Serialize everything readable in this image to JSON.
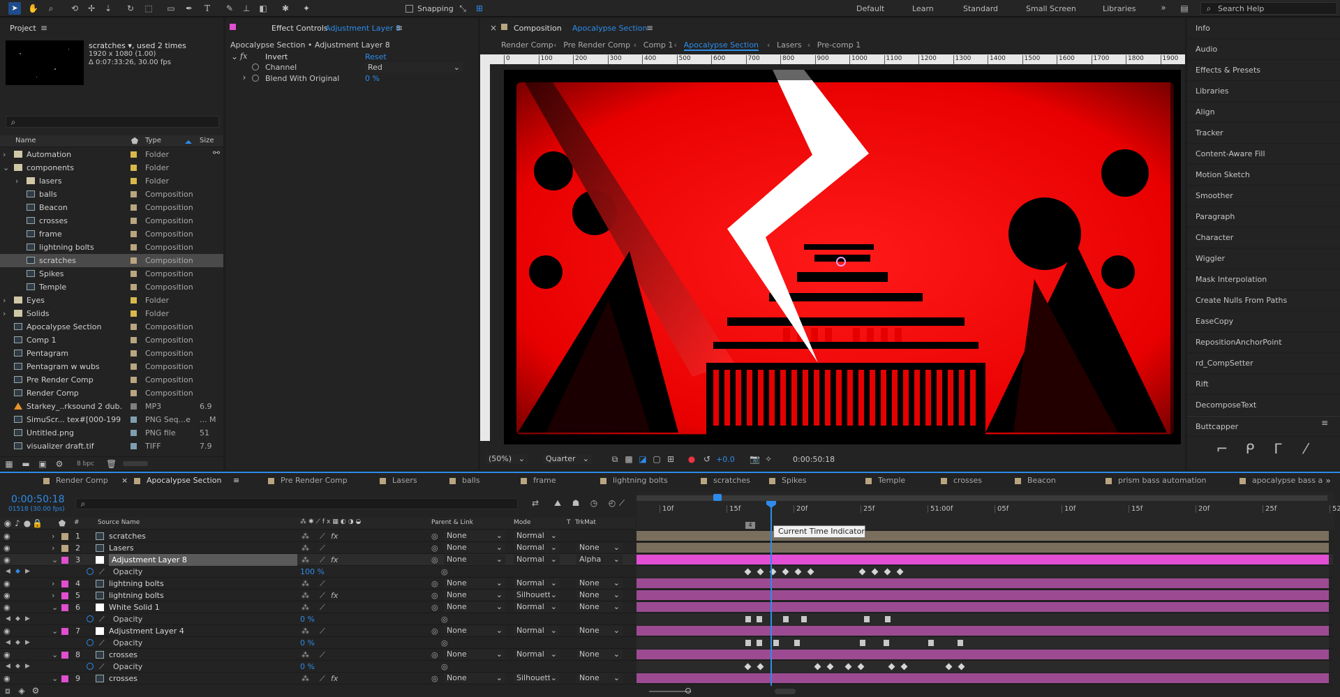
{
  "toolbar": {
    "snapping": "Snapping",
    "workspaces": [
      "Default",
      "Learn",
      "Standard",
      "Small Screen",
      "Libraries"
    ],
    "search_help": "Search Help"
  },
  "project": {
    "tab": "Project",
    "thumb_name": "scratches ▾, used 2 times",
    "thumb_res": "1920 x 1080 (1.00)",
    "thumb_dur": "Δ 0:07:33:26, 30.00 fps",
    "search_placeholder": "",
    "col_name": "Name",
    "col_type": "Type",
    "col_size": "Size",
    "bpc": "8 bpc",
    "items": [
      {
        "name": "Automation",
        "type": "Folder",
        "size": "",
        "kind": "folder",
        "indent": 0,
        "twirl": "›",
        "color": "#d7b94b"
      },
      {
        "name": "components",
        "type": "Folder",
        "size": "",
        "kind": "folder",
        "indent": 0,
        "twirl": "⌄",
        "color": "#d7b94b"
      },
      {
        "name": "lasers",
        "type": "Folder",
        "size": "",
        "kind": "folder",
        "indent": 1,
        "twirl": "›",
        "color": "#d7b94b"
      },
      {
        "name": "balls",
        "type": "Composition",
        "size": "",
        "kind": "comp",
        "indent": 1,
        "twirl": "",
        "color": "#b9a57f"
      },
      {
        "name": "Beacon",
        "type": "Composition",
        "size": "",
        "kind": "comp",
        "indent": 1,
        "twirl": "",
        "color": "#b9a57f"
      },
      {
        "name": "crosses",
        "type": "Composition",
        "size": "",
        "kind": "comp",
        "indent": 1,
        "twirl": "",
        "color": "#b9a57f"
      },
      {
        "name": "frame",
        "type": "Composition",
        "size": "",
        "kind": "comp",
        "indent": 1,
        "twirl": "",
        "color": "#b9a57f"
      },
      {
        "name": "lightning bolts",
        "type": "Composition",
        "size": "",
        "kind": "comp",
        "indent": 1,
        "twirl": "",
        "color": "#b9a57f"
      },
      {
        "name": "scratches",
        "type": "Composition",
        "size": "",
        "kind": "comp",
        "indent": 1,
        "twirl": "",
        "color": "#b9a57f",
        "selected": true
      },
      {
        "name": "Spikes",
        "type": "Composition",
        "size": "",
        "kind": "comp",
        "indent": 1,
        "twirl": "",
        "color": "#b9a57f"
      },
      {
        "name": "Temple",
        "type": "Composition",
        "size": "",
        "kind": "comp",
        "indent": 1,
        "twirl": "",
        "color": "#b9a57f"
      },
      {
        "name": "Eyes",
        "type": "Folder",
        "size": "",
        "kind": "folder",
        "indent": 0,
        "twirl": "›",
        "color": "#d7b94b"
      },
      {
        "name": "Solids",
        "type": "Folder",
        "size": "",
        "kind": "folder",
        "indent": 0,
        "twirl": "›",
        "color": "#d7b94b"
      },
      {
        "name": "Apocalypse Section",
        "type": "Composition",
        "size": "",
        "kind": "comp",
        "indent": 0,
        "twirl": "",
        "color": "#b9a57f"
      },
      {
        "name": "Comp 1",
        "type": "Composition",
        "size": "",
        "kind": "comp",
        "indent": 0,
        "twirl": "",
        "color": "#b9a57f"
      },
      {
        "name": "Pentagram",
        "type": "Composition",
        "size": "",
        "kind": "comp",
        "indent": 0,
        "twirl": "",
        "color": "#b9a57f"
      },
      {
        "name": "Pentagram w wubs",
        "type": "Composition",
        "size": "",
        "kind": "comp",
        "indent": 0,
        "twirl": "",
        "color": "#b9a57f"
      },
      {
        "name": "Pre Render Comp",
        "type": "Composition",
        "size": "",
        "kind": "comp",
        "indent": 0,
        "twirl": "",
        "color": "#b9a57f"
      },
      {
        "name": "Render Comp",
        "type": "Composition",
        "size": "",
        "kind": "comp",
        "indent": 0,
        "twirl": "",
        "color": "#b9a57f"
      },
      {
        "name": "Starkey_..rksound 2 dub.mp3",
        "type": "MP3",
        "size": "6.9",
        "kind": "audio",
        "indent": 0,
        "twirl": "",
        "color": "#7f7f7f"
      },
      {
        "name": "SimuScr... tex#[000-199].png",
        "type": "PNG Seq...e",
        "size": "... M",
        "kind": "seq",
        "indent": 0,
        "twirl": "",
        "color": "#7f9fb0"
      },
      {
        "name": "Untitled.png",
        "type": "PNG file",
        "size": "51",
        "kind": "img",
        "indent": 0,
        "twirl": "",
        "color": "#7f9fb0"
      },
      {
        "name": "visualizer draft.tif",
        "type": "TIFF",
        "size": "7.9",
        "kind": "tif",
        "indent": 0,
        "twirl": "",
        "color": "#7f9fb0"
      }
    ]
  },
  "effects": {
    "tab_prefix": "Effect Controls",
    "tab_layer": "Adjustment Layer 8",
    "subtitle": "Apocalypse Section • Adjustment Layer 8",
    "effect": "Invert",
    "reset": "Reset",
    "channel_label": "Channel",
    "channel_value": "Red",
    "blend_label": "Blend With Original",
    "blend_value": "0 %"
  },
  "composition": {
    "tab_prefix": "Composition",
    "tab_name": "Apocalypse Section",
    "crumbs": [
      "Render Comp",
      "Pre Render Comp",
      "Comp 1",
      "Apocalypse Section",
      "Lasers",
      "Pre-comp 1"
    ],
    "ruler": [
      "0",
      "100",
      "200",
      "300",
      "400",
      "500",
      "600",
      "700",
      "800",
      "900",
      "1000",
      "1100",
      "1200",
      "1300",
      "1400",
      "1500",
      "1600",
      "1700",
      "1800",
      "1900"
    ],
    "zoom": "(50%)",
    "resolution": "Quarter",
    "exposure": "+0.0",
    "timecode": "0:00:50:18"
  },
  "right_panels": [
    "Info",
    "Audio",
    "Effects & Presets",
    "Libraries",
    "Align",
    "Tracker",
    "Content-Aware Fill",
    "Motion Sketch",
    "Smoother",
    "Paragraph",
    "Character",
    "Wiggler",
    "Mask Interpolation",
    "Create Nulls From Paths",
    "EaseCopy",
    "RepositionAnchorPoint",
    "rd_CompSetter",
    "Rift",
    "DecomposeText",
    "Buttcapper"
  ],
  "timeline": {
    "tabs": [
      {
        "label": "Render Comp",
        "color": "#b9a57f"
      },
      {
        "label": "Apocalypse Section",
        "color": "#b9a57f",
        "active": true
      },
      {
        "label": "Pre Render Comp",
        "color": "#b9a57f"
      },
      {
        "label": "Lasers",
        "color": "#b9a57f"
      },
      {
        "label": "balls",
        "color": "#b9a57f"
      },
      {
        "label": "frame",
        "color": "#b9a57f"
      },
      {
        "label": "lightning bolts",
        "color": "#b9a57f"
      },
      {
        "label": "scratches",
        "color": "#b9a57f"
      },
      {
        "label": "Spikes",
        "color": "#b9a57f"
      },
      {
        "label": "Temple",
        "color": "#b9a57f"
      },
      {
        "label": "crosses",
        "color": "#b9a57f"
      },
      {
        "label": "Beacon",
        "color": "#b9a57f"
      },
      {
        "label": "prism bass automation",
        "color": "#b9a57f"
      },
      {
        "label": "apocalypse bass a",
        "color": "#b9a57f"
      }
    ],
    "timecode": "0:00:50:18",
    "frames": "01518 (30.00 fps)",
    "col_source": "Source Name",
    "col_parent": "Parent & Link",
    "col_mode": "Mode",
    "col_t": "T",
    "col_trkmat": "TrkMat",
    "ruler": [
      "10f",
      "15f",
      "20f",
      "25f",
      "51:00f",
      "05f",
      "10f",
      "15f",
      "20f",
      "25f",
      "52"
    ],
    "tooltip": "Current Time Indicator",
    "layers": [
      {
        "num": "1",
        "name": "scratches",
        "parent": "None",
        "mode": "Normal",
        "trk": "",
        "color": "#b9a57f",
        "kind": "comp",
        "fx": true,
        "bar": "#7a6f5c",
        "twirl": "›"
      },
      {
        "num": "2",
        "name": "Lasers",
        "parent": "None",
        "mode": "Normal",
        "trk": "None",
        "color": "#b9a57f",
        "kind": "comp",
        "fx": false,
        "bar": "#7a6f5c",
        "twirl": "›"
      },
      {
        "num": "3",
        "name": "Adjustment Layer 8",
        "parent": "None",
        "mode": "Normal",
        "trk": "Alpha",
        "color": "#e14fd0",
        "kind": "adj",
        "fx": true,
        "bar": "#d43fc6",
        "twirl": "⌄",
        "selected": true
      },
      {
        "prop": true,
        "name": "Opacity",
        "value": "100 %"
      },
      {
        "num": "4",
        "name": "lightning bolts",
        "parent": "None",
        "mode": "Normal",
        "trk": "None",
        "color": "#e14fd0",
        "kind": "comp",
        "fx": false,
        "bar": "#9c4b93",
        "twirl": "›"
      },
      {
        "num": "5",
        "name": "lightning bolts",
        "parent": "None",
        "mode": "Silhouett",
        "trk": "None",
        "color": "#e14fd0",
        "kind": "comp",
        "fx": true,
        "bar": "#9c4b93",
        "twirl": "›"
      },
      {
        "num": "6",
        "name": "White Solid 1",
        "parent": "None",
        "mode": "Normal",
        "trk": "None",
        "color": "#e14fd0",
        "kind": "solid",
        "fx": false,
        "bar": "#9c4b93",
        "twirl": "⌄"
      },
      {
        "prop": true,
        "name": "Opacity",
        "value": "0 %"
      },
      {
        "num": "7",
        "name": "Adjustment Layer 4",
        "parent": "None",
        "mode": "Normal",
        "trk": "None",
        "color": "#e14fd0",
        "kind": "adj",
        "fx": false,
        "bar": "#9c4b93",
        "twirl": "⌄"
      },
      {
        "prop": true,
        "name": "Opacity",
        "value": "0 %"
      },
      {
        "num": "8",
        "name": "crosses",
        "parent": "None",
        "mode": "Normal",
        "trk": "None",
        "color": "#e14fd0",
        "kind": "comp",
        "fx": false,
        "bar": "#9c4b93",
        "twirl": "⌄"
      },
      {
        "prop": true,
        "name": "Opacity",
        "value": "0 %"
      },
      {
        "num": "9",
        "name": "crosses",
        "parent": "None",
        "mode": "Silhouett",
        "trk": "None",
        "color": "#e14fd0",
        "kind": "comp",
        "fx": true,
        "bar": "#9c4b93",
        "twirl": "⌄"
      }
    ]
  },
  "colors": {
    "accent": "#2d8ceb",
    "bg": "#1d1d1d",
    "panel": "#232323",
    "pink_layer": "#d43fc6",
    "tan_layer": "#7a6f5c"
  }
}
